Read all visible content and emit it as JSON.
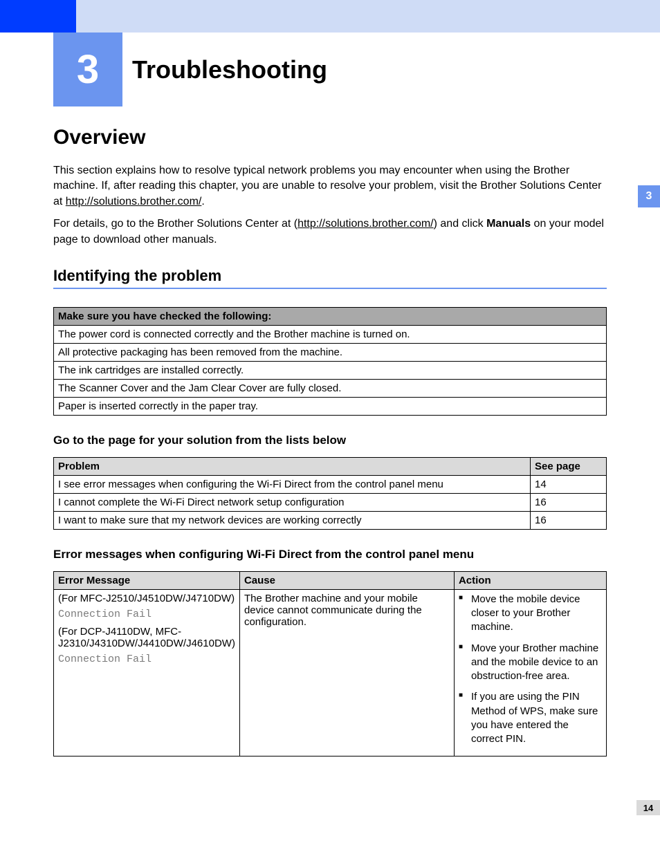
{
  "chapter": {
    "number": "3",
    "title": "Troubleshooting",
    "tab": "3"
  },
  "section": {
    "title": "Overview"
  },
  "para1": {
    "a": "This section explains how to resolve typical network problems you may encounter when using the Brother machine. If, after reading this chapter, you are unable to resolve your problem, visit the Brother Solutions Center at ",
    "link": "http://solutions.brother.com/",
    "b": "."
  },
  "para2": {
    "a": "For details, go to the Brother Solutions Center at (",
    "link": "http://solutions.brother.com/",
    "b": ") and click ",
    "bold": "Manuals",
    "c": " on your model page to download other manuals."
  },
  "identify": {
    "title": "Identifying the problem",
    "checklist_header": "Make sure you have checked the following:",
    "checklist": [
      "The power cord is connected correctly and the Brother machine is turned on.",
      "All protective packaging has been removed from the machine.",
      "The ink cartridges are installed correctly.",
      "The Scanner Cover and the Jam Clear Cover are fully closed.",
      "Paper is inserted correctly in the paper tray."
    ]
  },
  "golist": {
    "title": "Go to the page for your solution from the lists below",
    "h_problem": "Problem",
    "h_page": "See page",
    "rows": [
      {
        "p": "I see error messages when configuring the Wi-Fi Direct from the control panel menu",
        "pg": "14"
      },
      {
        "p": "I cannot complete the Wi-Fi Direct network setup configuration",
        "pg": "16"
      },
      {
        "p": "I want to make sure that my network devices are working correctly",
        "pg": "16"
      }
    ]
  },
  "errtbl": {
    "title": "Error messages when configuring Wi-Fi Direct from the control panel menu",
    "h_err": "Error Message",
    "h_cause": "Cause",
    "h_action": "Action",
    "row": {
      "models1": "(For MFC-J2510/J4510DW/J4710DW)",
      "msg1": "Connection Fail",
      "models2": "(For DCP-J4110DW, MFC-J2310/J4310DW/J4410DW/J4610DW)",
      "msg2": "Connection Fail",
      "cause": "The Brother machine and your mobile device cannot communicate during the configuration.",
      "actions": [
        "Move the mobile device closer to your Brother machine.",
        "Move your Brother machine and the mobile device to an obstruction-free area.",
        "If you are using the PIN Method of WPS, make sure you have entered the correct PIN."
      ]
    }
  },
  "page_number": "14"
}
